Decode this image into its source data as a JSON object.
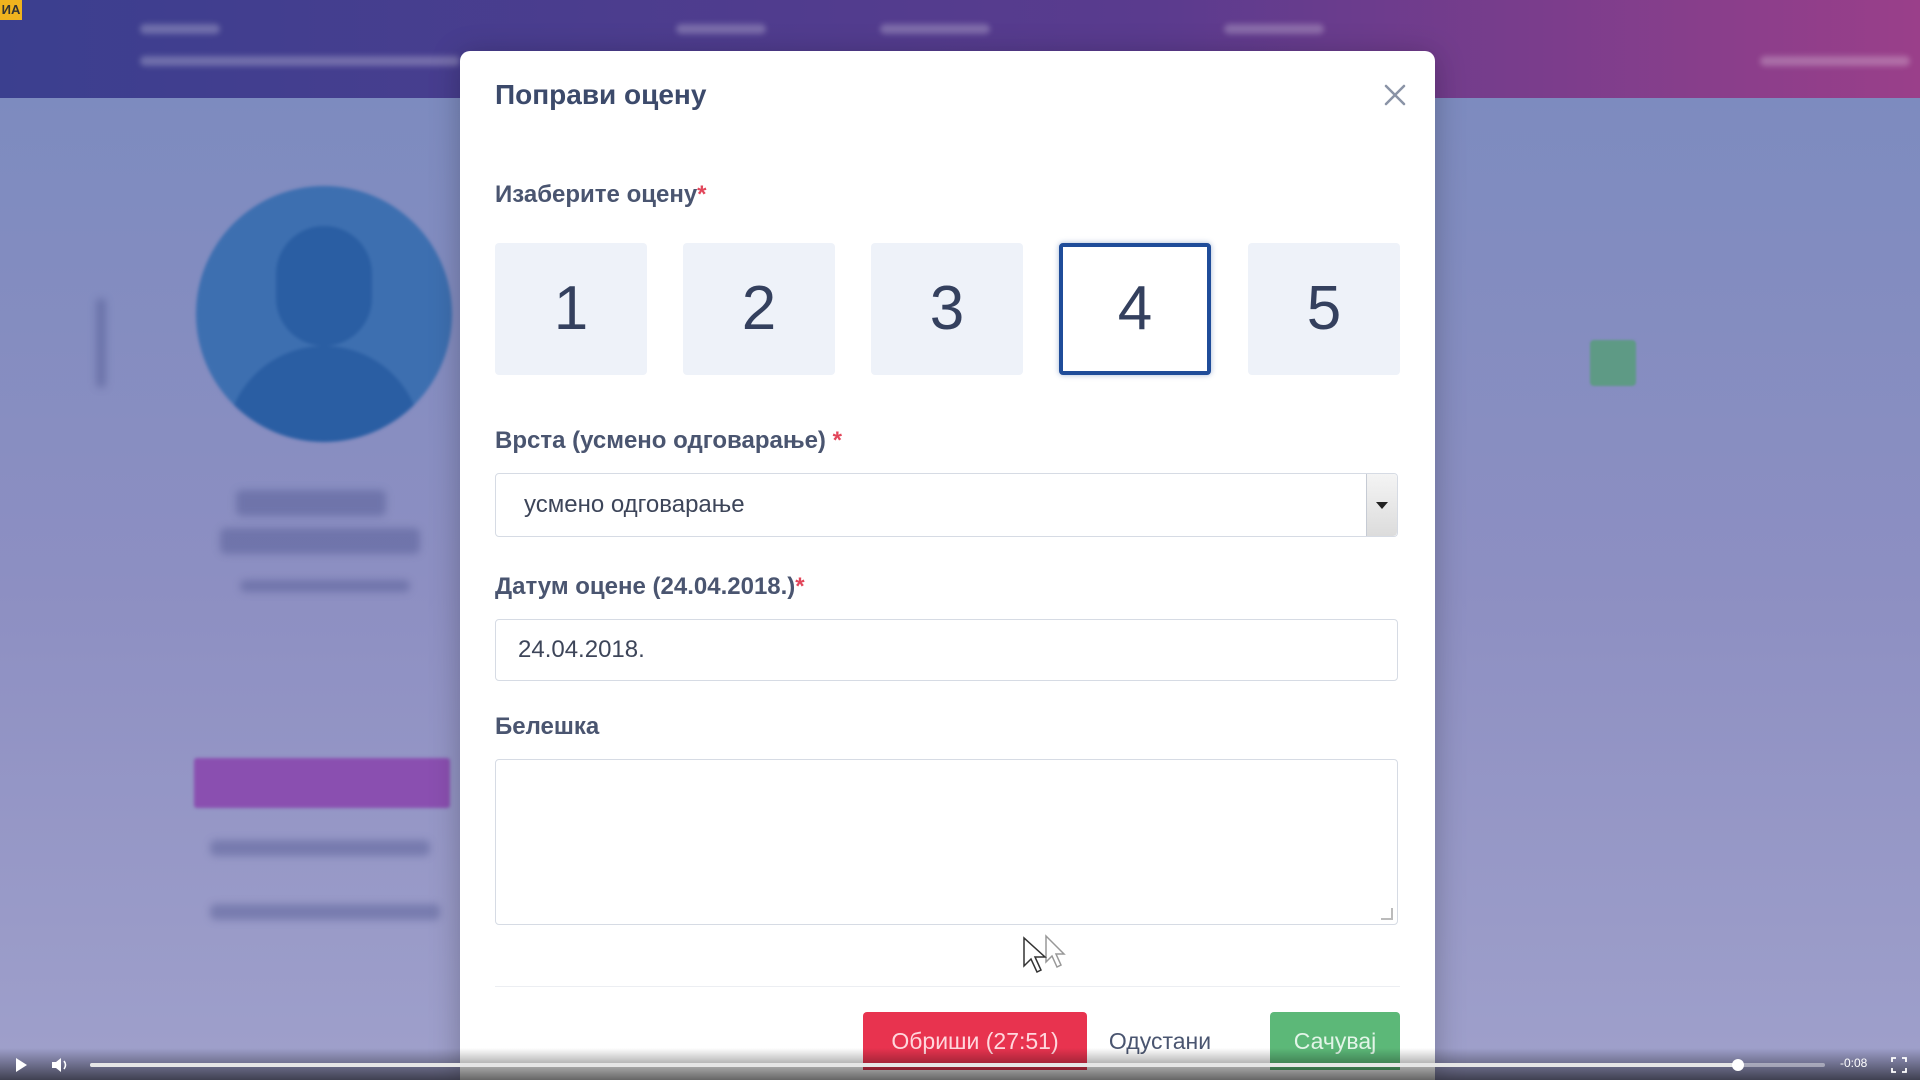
{
  "background": {
    "logo_text": "ИА"
  },
  "modal": {
    "title": "Поправи оцену",
    "grade_label": "Изаберите оцену",
    "required_mark": "*",
    "grades": [
      "1",
      "2",
      "3",
      "4",
      "5"
    ],
    "selected_grade": "4",
    "type_label": "Врста (усмено одговарање) ",
    "type_value": "усмено одговарање",
    "date_label": "Датум оцене (24.04.2018.)",
    "date_value": "24.04.2018.",
    "note_label": "Белешка",
    "note_value": "",
    "delete_button": "Обриши (27:51)",
    "cancel_button": "Одустани",
    "save_button": "Сачувај"
  },
  "player": {
    "time": "-0:08",
    "progress": 0.95
  },
  "colors": {
    "accent": "#1f4c99",
    "delete": "#e8334f",
    "save": "#5cb878",
    "required": "#e2465a"
  }
}
